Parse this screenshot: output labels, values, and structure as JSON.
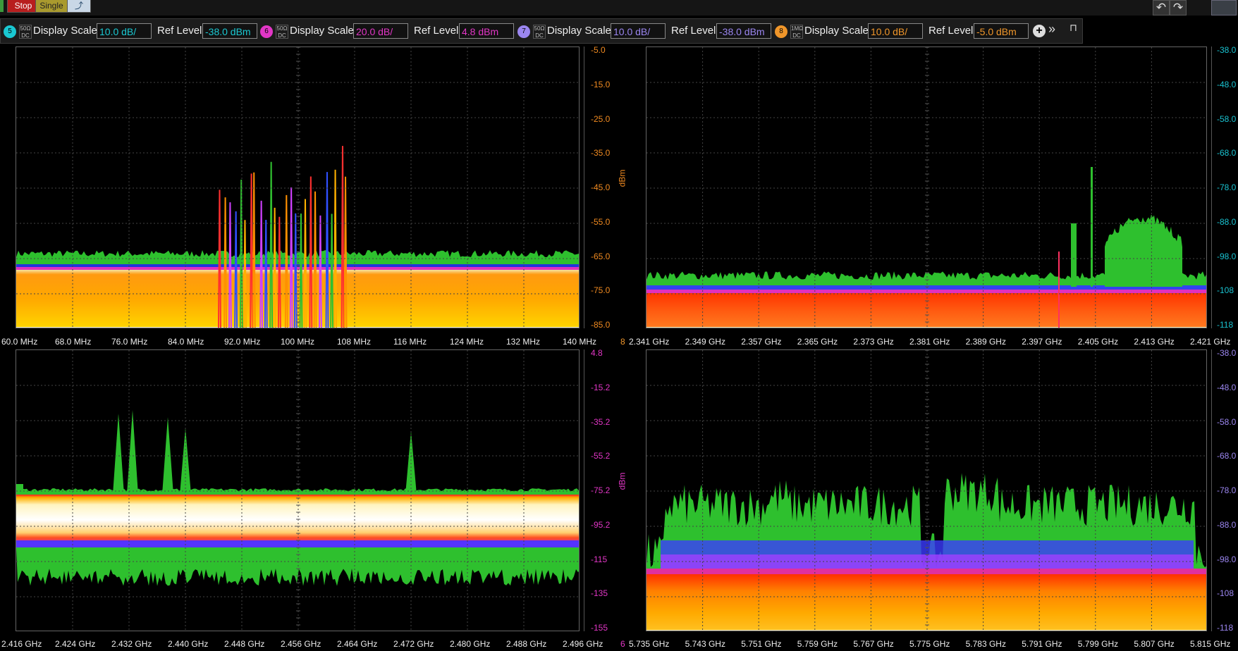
{
  "topbar": {
    "stop_label": "Stop",
    "single_label": "Single"
  },
  "toolbar": {
    "traces": [
      {
        "number": "5",
        "couple_top": "50Ω",
        "couple_bottom": "DC",
        "scale_label": "Display Scale",
        "scale_value": "10.0 dB/",
        "ref_label": "Ref Level",
        "ref_value": "-38.0 dBm",
        "color": "#1ac8d2"
      },
      {
        "number": "6",
        "couple_top": "50Ω",
        "couple_bottom": "DC",
        "scale_label": "Display Scale",
        "scale_value": "20.0 dB/",
        "ref_label": "Ref Level",
        "ref_value": "4.8 dBm",
        "color": "#e236c6"
      },
      {
        "number": "7",
        "couple_top": "50Ω",
        "couple_bottom": "DC",
        "scale_label": "Display Scale",
        "scale_value": "10.0 dB/",
        "ref_label": "Ref Level",
        "ref_value": "-38.0 dBm",
        "color": "#9b86f0"
      },
      {
        "number": "8",
        "couple_top": "1MΩ",
        "couple_bottom": "DC",
        "scale_label": "Display Scale",
        "scale_value": "10.0 dB/",
        "ref_label": "Ref Level",
        "ref_value": "-5.0 dBm",
        "color": "#f0962a"
      }
    ]
  },
  "panels": [
    {
      "id": "p1",
      "trace_num": "",
      "y_unit": "dBm",
      "y_color": "#f08a20",
      "y_ticks": [
        "-5.0",
        "-15.0",
        "-25.0",
        "-35.0",
        "-45.0",
        "-55.0",
        "-65.0",
        "-75.0",
        "-85.0"
      ],
      "x_ticks": [
        "60.0 MHz",
        "68.0 MHz",
        "76.0 MHz",
        "84.0 MHz",
        "92.0 MHz",
        "100 MHz",
        "108 MHz",
        "116 MHz",
        "124 MHz",
        "132 MHz",
        "140 MHz"
      ],
      "profile": "fm"
    },
    {
      "id": "p2",
      "trace_num": "8",
      "y_unit": "",
      "y_color": "#19c2d0",
      "y_ticks": [
        "-38.0",
        "-48.0",
        "-58.0",
        "-68.0",
        "-78.0",
        "-88.0",
        "-98.0",
        "-108",
        "-118"
      ],
      "x_ticks": [
        "2.341 GHz",
        "2.349 GHz",
        "2.357 GHz",
        "2.365 GHz",
        "2.373 GHz",
        "2.381 GHz",
        "2.389 GHz",
        "2.397 GHz",
        "2.405 GHz",
        "2.413 GHz",
        "2.421 GHz"
      ],
      "profile": "wifi24a"
    },
    {
      "id": "p3",
      "trace_num": "",
      "y_unit": "dBm",
      "y_color": "#e236c6",
      "y_ticks": [
        "4.8",
        "-15.2",
        "-35.2",
        "-55.2",
        "-75.2",
        "-95.2",
        "-115",
        "-135",
        "-155"
      ],
      "x_ticks": [
        "2.416 GHz",
        "2.424 GHz",
        "2.432 GHz",
        "2.440 GHz",
        "2.448 GHz",
        "2.456 GHz",
        "2.464 GHz",
        "2.472 GHz",
        "2.480 GHz",
        "2.488 GHz",
        "2.496 GHz"
      ],
      "profile": "wifi24b"
    },
    {
      "id": "p4",
      "trace_num": "6",
      "y_unit": "",
      "y_color": "#9b86f0",
      "y_ticks": [
        "-38.0",
        "-48.0",
        "-58.0",
        "-68.0",
        "-78.0",
        "-88.0",
        "-98.0",
        "-108",
        "-118"
      ],
      "x_ticks": [
        "5.735 GHz",
        "5.743 GHz",
        "5.751 GHz",
        "5.759 GHz",
        "5.767 GHz",
        "5.775 GHz",
        "5.783 GHz",
        "5.791 GHz",
        "5.799 GHz",
        "5.807 GHz",
        "5.815 GHz"
      ],
      "profile": "wifi58"
    }
  ]
}
